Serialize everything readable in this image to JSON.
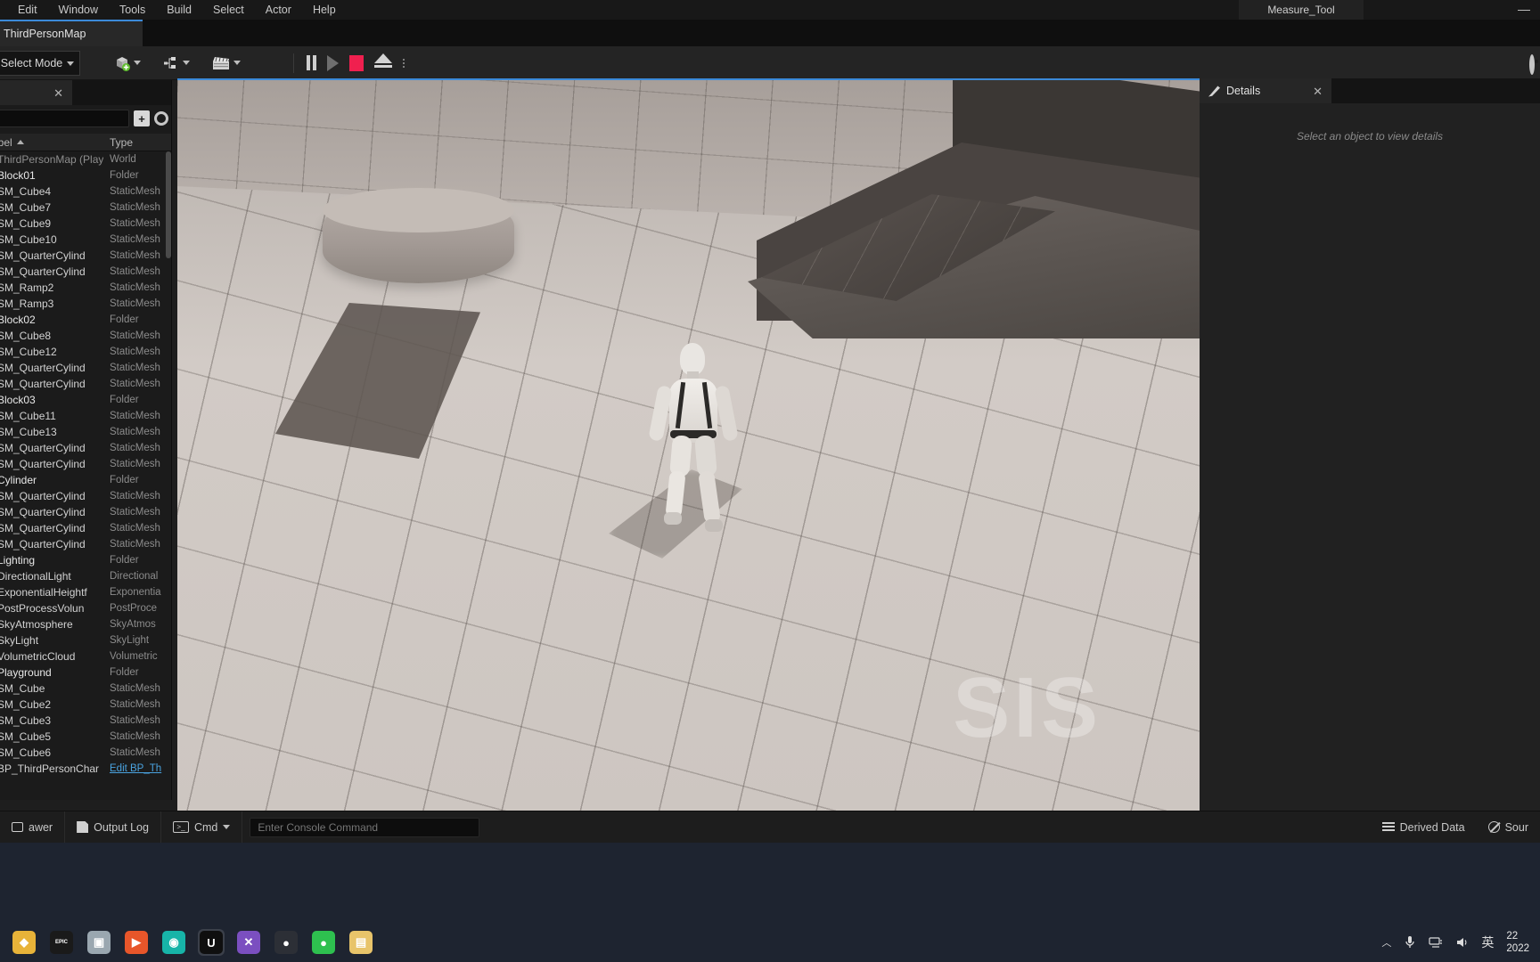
{
  "window": {
    "title": "Measure_Tool",
    "minimize_label": "—"
  },
  "menubar": {
    "items": [
      {
        "label": "Edit"
      },
      {
        "label": "Window"
      },
      {
        "label": "Tools"
      },
      {
        "label": "Build"
      },
      {
        "label": "Select"
      },
      {
        "label": "Actor"
      },
      {
        "label": "Help"
      }
    ]
  },
  "tabstrip": {
    "map_tab_label": "ThirdPersonMap"
  },
  "toolbar": {
    "mode_label": "Select Mode",
    "mode_caret": "▾",
    "buttons": [
      {
        "name": "create-actor",
        "icon": "cube-plus-icon"
      },
      {
        "name": "blueprints",
        "icon": "blueprint-icon"
      },
      {
        "name": "cinematics",
        "icon": "clapperboard-icon"
      }
    ],
    "play_controls": [
      {
        "name": "pause-button",
        "icon": "pause-icon"
      },
      {
        "name": "step-button",
        "icon": "step-forward-icon"
      },
      {
        "name": "stop-button",
        "icon": "stop-icon"
      },
      {
        "name": "eject-button",
        "icon": "eject-icon"
      },
      {
        "name": "more-options-button",
        "icon": "kebab-icon"
      }
    ]
  },
  "outliner": {
    "tab_close": "✕",
    "search": {
      "value": "",
      "placeholder": ""
    },
    "columns": {
      "label": "abel",
      "type": "Type"
    },
    "rows": [
      {
        "label": "ThirdPersonMap (Play",
        "type": "World",
        "kind": "world"
      },
      {
        "label": "Block01",
        "type": "Folder",
        "kind": "folder"
      },
      {
        "label": "SM_Cube4",
        "type": "StaticMesh",
        "kind": "mesh"
      },
      {
        "label": "SM_Cube7",
        "type": "StaticMesh",
        "kind": "mesh"
      },
      {
        "label": "SM_Cube9",
        "type": "StaticMesh",
        "kind": "mesh"
      },
      {
        "label": "SM_Cube10",
        "type": "StaticMesh",
        "kind": "mesh"
      },
      {
        "label": "SM_QuarterCylind",
        "type": "StaticMesh",
        "kind": "mesh"
      },
      {
        "label": "SM_QuarterCylind",
        "type": "StaticMesh",
        "kind": "mesh"
      },
      {
        "label": "SM_Ramp2",
        "type": "StaticMesh",
        "kind": "mesh"
      },
      {
        "label": "SM_Ramp3",
        "type": "StaticMesh",
        "kind": "mesh"
      },
      {
        "label": "Block02",
        "type": "Folder",
        "kind": "folder"
      },
      {
        "label": "SM_Cube8",
        "type": "StaticMesh",
        "kind": "mesh"
      },
      {
        "label": "SM_Cube12",
        "type": "StaticMesh",
        "kind": "mesh"
      },
      {
        "label": "SM_QuarterCylind",
        "type": "StaticMesh",
        "kind": "mesh"
      },
      {
        "label": "SM_QuarterCylind",
        "type": "StaticMesh",
        "kind": "mesh"
      },
      {
        "label": "Block03",
        "type": "Folder",
        "kind": "folder"
      },
      {
        "label": "SM_Cube11",
        "type": "StaticMesh",
        "kind": "mesh"
      },
      {
        "label": "SM_Cube13",
        "type": "StaticMesh",
        "kind": "mesh"
      },
      {
        "label": "SM_QuarterCylind",
        "type": "StaticMesh",
        "kind": "mesh"
      },
      {
        "label": "SM_QuarterCylind",
        "type": "StaticMesh",
        "kind": "mesh"
      },
      {
        "label": "Cylinder",
        "type": "Folder",
        "kind": "folder"
      },
      {
        "label": "SM_QuarterCylind",
        "type": "StaticMesh",
        "kind": "mesh"
      },
      {
        "label": "SM_QuarterCylind",
        "type": "StaticMesh",
        "kind": "mesh"
      },
      {
        "label": "SM_QuarterCylind",
        "type": "StaticMesh",
        "kind": "mesh"
      },
      {
        "label": "SM_QuarterCylind",
        "type": "StaticMesh",
        "kind": "mesh"
      },
      {
        "label": "Lighting",
        "type": "Folder",
        "kind": "folder"
      },
      {
        "label": "DirectionalLight",
        "type": "Directional",
        "kind": "light"
      },
      {
        "label": "ExponentialHeightf",
        "type": "Exponentia",
        "kind": "fog"
      },
      {
        "label": "PostProcessVolun",
        "type": "PostProce",
        "kind": "volume"
      },
      {
        "label": "SkyAtmosphere",
        "type": "SkyAtmos",
        "kind": "sky"
      },
      {
        "label": "SkyLight",
        "type": "SkyLight",
        "kind": "skylight"
      },
      {
        "label": "VolumetricCloud",
        "type": "Volumetric",
        "kind": "cloud"
      },
      {
        "label": "Playground",
        "type": "Folder",
        "kind": "folder"
      },
      {
        "label": "SM_Cube",
        "type": "StaticMesh",
        "kind": "mesh"
      },
      {
        "label": "SM_Cube2",
        "type": "StaticMesh",
        "kind": "mesh"
      },
      {
        "label": "SM_Cube3",
        "type": "StaticMesh",
        "kind": "mesh"
      },
      {
        "label": "SM_Cube5",
        "type": "StaticMesh",
        "kind": "mesh"
      },
      {
        "label": "SM_Cube6",
        "type": "StaticMesh",
        "kind": "mesh"
      },
      {
        "label": "BP_ThirdPersonChar",
        "type": "Edit BP_Th",
        "kind": "blueprint"
      }
    ]
  },
  "details": {
    "tab_label": "Details",
    "tab_close": "✕",
    "empty_message": "Select an object to view details"
  },
  "viewport": {
    "watermark": "SIS"
  },
  "statusbar": {
    "content_drawer_label": "awer",
    "output_log_label": "Output Log",
    "cmd_label": "Cmd",
    "cmd_caret": "▾",
    "console_placeholder": "Enter Console Command",
    "console_value": "",
    "derived_data_label": "Derived Data",
    "source_control_label": "Sour"
  },
  "taskbar": {
    "apps": [
      {
        "name": "taskbar-app-folder-orange",
        "glyph": "◆",
        "color": "#e8b339",
        "active": false
      },
      {
        "name": "taskbar-app-epic-games",
        "glyph": "EPIC",
        "color": "#1a1a1a",
        "active": false
      },
      {
        "name": "taskbar-app-photos",
        "glyph": "▣",
        "color": "#9aa7b0",
        "active": false
      },
      {
        "name": "taskbar-app-media",
        "glyph": "▶",
        "color": "#e8562a",
        "active": false
      },
      {
        "name": "taskbar-app-edge",
        "glyph": "◉",
        "color": "#17b4a8",
        "active": false
      },
      {
        "name": "taskbar-app-unreal-engine",
        "glyph": "U",
        "color": "#0f0f0f",
        "active": true
      },
      {
        "name": "taskbar-app-visual-studio",
        "glyph": "✕",
        "color": "#7b4fc0",
        "active": false
      },
      {
        "name": "taskbar-app-obs",
        "glyph": "●",
        "color": "#2c2f36",
        "active": false
      },
      {
        "name": "taskbar-app-wechat",
        "glyph": "●",
        "color": "#2ec04f",
        "active": false
      },
      {
        "name": "taskbar-app-file-explorer",
        "glyph": "▤",
        "color": "#e8c46a",
        "active": false
      }
    ],
    "tray": {
      "chevron": "︿",
      "mic_icon": "mic-icon",
      "network_icon": "network-icon",
      "volume_icon": "volume-icon",
      "ime_label": "英",
      "clock_time": "22",
      "clock_date": "2022"
    }
  }
}
